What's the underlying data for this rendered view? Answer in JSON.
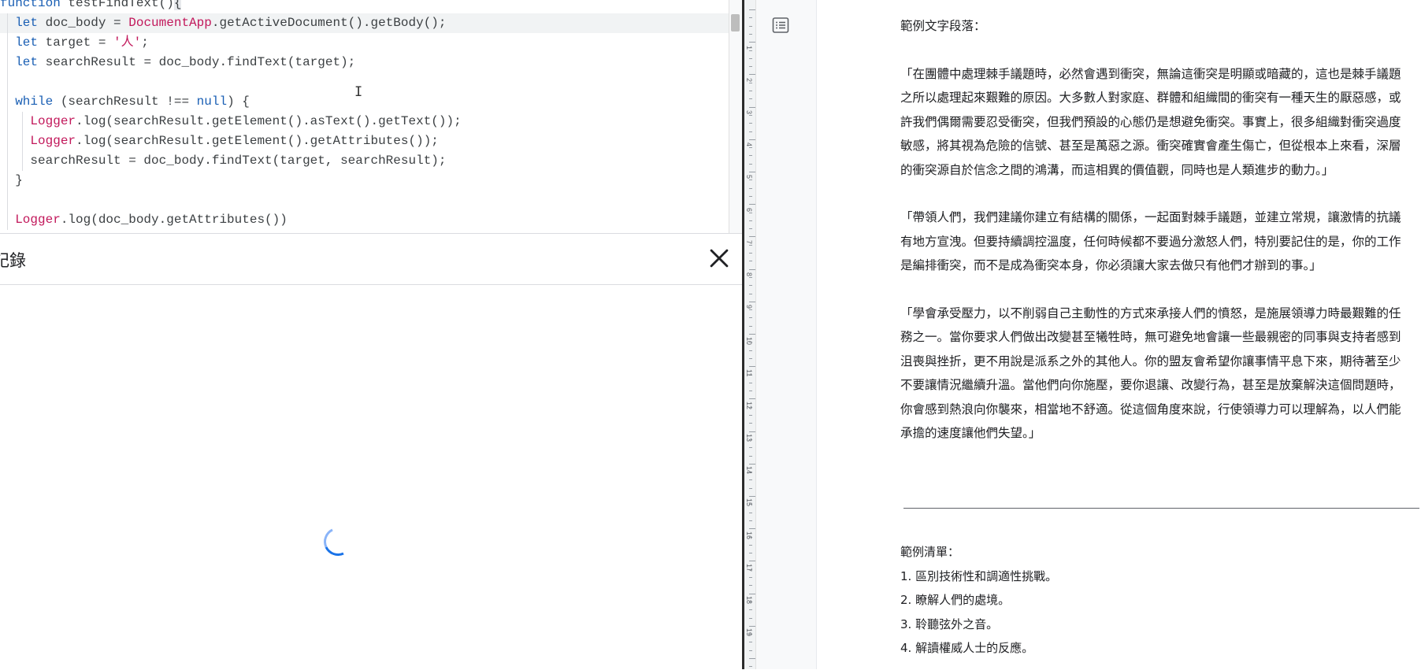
{
  "editor": {
    "code_lines": [
      [
        {
          "t": "function",
          "c": "kw"
        },
        {
          "t": " testFindText()"
        },
        {
          "t": "{",
          "c": "bk"
        }
      ],
      [
        {
          "t": "  "
        },
        {
          "t": "let",
          "c": "kw"
        },
        {
          "t": " doc_body = "
        },
        {
          "t": "DocumentApp",
          "c": "cls"
        },
        {
          "t": ".getActiveDocument().getBody();"
        }
      ],
      [
        {
          "t": "  "
        },
        {
          "t": "let",
          "c": "kw"
        },
        {
          "t": " target = "
        },
        {
          "t": "'人'",
          "c": "str"
        },
        {
          "t": ";"
        }
      ],
      [
        {
          "t": "  "
        },
        {
          "t": "let",
          "c": "kw"
        },
        {
          "t": " searchResult = doc_body.findText(target);"
        }
      ],
      [],
      [
        {
          "t": "  "
        },
        {
          "t": "while",
          "c": "kw"
        },
        {
          "t": " (searchResult !== "
        },
        {
          "t": "null",
          "c": "kw"
        },
        {
          "t": ") {"
        }
      ],
      [
        {
          "t": "    "
        },
        {
          "t": "Logger",
          "c": "cls"
        },
        {
          "t": ".log(searchResult.getElement().asText().getText());"
        }
      ],
      [
        {
          "t": "    "
        },
        {
          "t": "Logger",
          "c": "cls"
        },
        {
          "t": ".log(searchResult.getElement().getAttributes());"
        }
      ],
      [
        {
          "t": "    searchResult = doc_body.findText(target, searchResult);"
        }
      ],
      [
        {
          "t": "  }"
        }
      ],
      [],
      [
        {
          "t": "  "
        },
        {
          "t": "Logger",
          "c": "cls"
        },
        {
          "t": ".log(doc_body.getAttributes())"
        }
      ]
    ],
    "current_line": 1
  },
  "log_panel": {
    "title": "記錄",
    "close_icon": "close-icon",
    "status": "loading"
  },
  "doc": {
    "heading_text": "範例文字段落：",
    "paragraphs": [
      [
        "「在團體中處理棘手議題時，必然會遇到衝突，無論這衝突是明顯或暗藏的，這也是棘手議題",
        "之所以處理起來艱難的原因。大多數人對家庭、群體和組織間的衝突有一種天生的厭惡感，或",
        "許我們偶爾需要忍受衝突，但我們預設的心態仍是想避免衝突。事實上，很多組織對衝突過度",
        "敏感，將其視為危險的信號、甚至是萬惡之源。衝突確實會產生傷亡，但從根本上來看，深層",
        "的衝突源自於信念之間的鴻溝，而這相異的價值觀，同時也是人類進步的動力。」"
      ],
      [
        "「帶領人們，我們建議你建立有結構的關係，一起面對棘手議題，並建立常規，讓激情的抗議",
        "有地方宣洩。但要持續調控溫度，任何時候都不要過分激怒人們，特別要記住的是，你的工作",
        "是編排衝突，而不是成為衝突本身，你必須讓大家去做只有他們才辦到的事。」"
      ],
      [
        "「學會承受壓力，以不削弱自己主動性的方式來承接人們的憤怒，是施展領導力時最艱難的任",
        "務之一。當你要求人們做出改變甚至犧牲時，無可避免地會讓一些最親密的同事與支持者感到",
        "沮喪與挫折，更不用說是派系之外的其他人。你的盟友會希望你讓事情平息下來，期待著至少",
        "不要讓情況繼續升溫。當他們向你施壓，要你退讓、改變行為，甚至是放棄解決這個問題時，",
        "你會感到熱浪向你襲來，相當地不舒適。從這個角度來說，行使領導力可以理解為，以人們能",
        "承擔的速度讓他們失望。」"
      ]
    ],
    "list_heading": "範例清單：",
    "list_items": [
      "1. 區別技術性和調適性挑戰。",
      "2. 瞭解人們的處境。",
      "3. 聆聽弦外之音。",
      "4. 解讀權威人士的反應。"
    ],
    "ruler_numbers": [
      "1",
      "2",
      "3",
      "4",
      "5",
      "6",
      "7",
      "8",
      "9",
      "10",
      "11",
      "12",
      "13",
      "14",
      "15",
      "16",
      "17",
      "18",
      "19"
    ],
    "outline_icon": "document-outline-icon"
  }
}
